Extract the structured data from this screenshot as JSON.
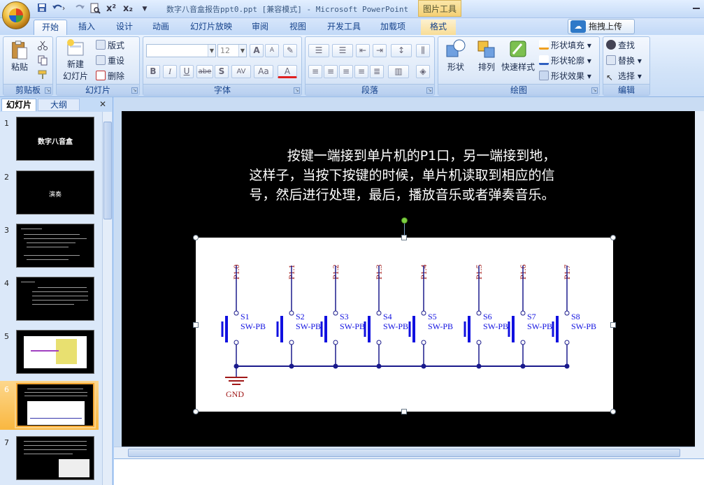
{
  "app": {
    "window_title": "数字八音盒报告ppt0.ppt [兼容模式] - Microsoft PowerPoint",
    "contextual_tab_group": "图片工具"
  },
  "quick_access": {
    "icons": [
      "save-icon",
      "undo-icon",
      "redo-icon",
      "print-preview-icon",
      "superscript-icon",
      "subscript-icon",
      "customize-qat-icon"
    ],
    "superscript": "x²",
    "subscript": "x₂"
  },
  "tabs": [
    "开始",
    "插入",
    "设计",
    "动画",
    "幻灯片放映",
    "审阅",
    "视图",
    "开发工具",
    "加载项",
    "格式"
  ],
  "active_tab": "开始",
  "upload_button": "拖拽上传",
  "ribbon": {
    "clipboard": {
      "label": "剪贴板",
      "paste": "粘贴"
    },
    "slides": {
      "label": "幻灯片",
      "new_slide_line1": "新建",
      "new_slide_line2": "幻灯片",
      "layout": "版式",
      "reset": "重设",
      "delete": "删除"
    },
    "font": {
      "label": "字体",
      "font_size": "12",
      "bold": "B",
      "italic": "I",
      "underline": "U",
      "strike": "abe",
      "shadow": "S",
      "spacing": "AV",
      "case": "Aa",
      "color": "A",
      "grow": "A",
      "shrink": "A"
    },
    "paragraph": {
      "label": "段落"
    },
    "drawing": {
      "label": "绘图",
      "shape": "形状",
      "arrange": "排列",
      "quick_styles": "快速样式",
      "fill": "形状填充",
      "outline": "形状轮廓",
      "effects": "形状效果"
    },
    "editing": {
      "label": "编辑",
      "find": "查找",
      "replace": "替换",
      "select": "选择"
    }
  },
  "panel": {
    "tab_slides": "幻灯片",
    "tab_outline": "大纲",
    "thumbnails": [
      {
        "num": "1",
        "title": "数字八音盒"
      },
      {
        "num": "2",
        "title": "演奏"
      },
      {
        "num": "3",
        "title": ""
      },
      {
        "num": "4",
        "title": ""
      },
      {
        "num": "5",
        "title": ""
      },
      {
        "num": "6",
        "title": ""
      },
      {
        "num": "7",
        "title": ""
      }
    ],
    "selected": "6"
  },
  "slide": {
    "text_line1": "按键一端接到单片机的P1口，另一端接到地，",
    "text_line2": "这样子，当按下按键的时候，单片机读取到相应的信",
    "text_line3": "号，然后进行处理，最后，播放音乐或者弹奏音乐。",
    "circuit": {
      "pins": [
        "P1.0",
        "P1.1",
        "P1.2",
        "P1.3",
        "P1.4",
        "P1.5",
        "P1.6",
        "P1.7"
      ],
      "switches": [
        "S1",
        "S2",
        "S3",
        "S4",
        "S5",
        "S6",
        "S7",
        "S8"
      ],
      "switch_type": "SW-PB",
      "ground": "GND",
      "wire_color": "#1a1a8c",
      "switch_color": "#1010e0",
      "label_color": "#a01818"
    }
  }
}
